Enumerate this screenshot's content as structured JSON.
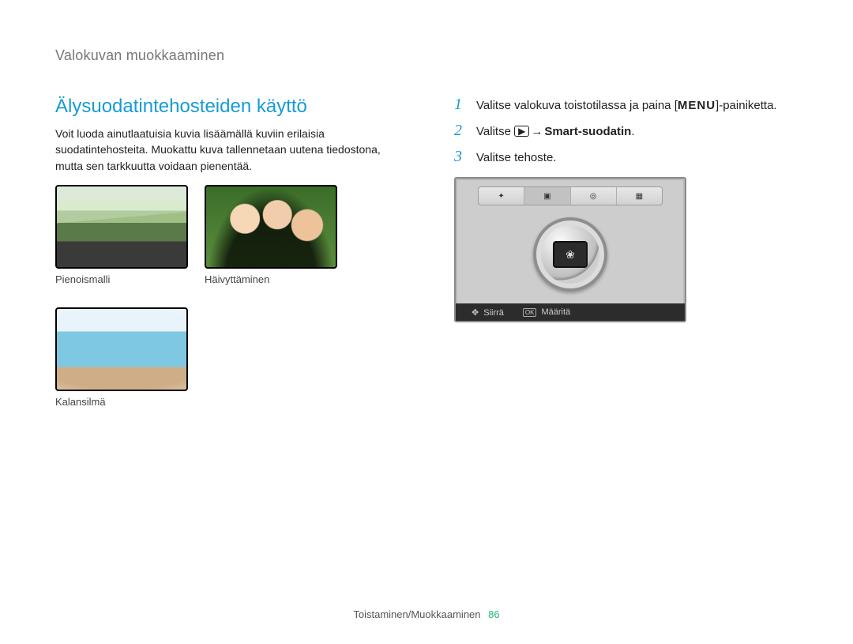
{
  "header": {
    "title": "Valokuvan muokkaaminen"
  },
  "section": {
    "title": "Älysuodatintehosteiden käyttö",
    "intro": "Voit luoda ainutlaatuisia kuvia lisäämällä kuviin erilaisia suodatintehosteita. Muokattu kuva tallennetaan uutena tiedostona, mutta sen tarkkuutta voidaan pienentää."
  },
  "thumbs": {
    "t1": "Pienoismalli",
    "t2": "Häivyttäminen",
    "t3": "Kalansilmä"
  },
  "steps": {
    "s1_pre": "Valitse valokuva toistotilassa ja paina [",
    "s1_key": "MENU",
    "s1_post": "]-painiketta.",
    "s2_pre": "Valitse ",
    "s2_tri": "▶",
    "s2_arrow": " → ",
    "s2_bold": "Smart-suodatin",
    "s2_post": ".",
    "s3": "Valitse tehoste."
  },
  "cam": {
    "move": "Siirrä",
    "ok": "OK",
    "set": "Määritä"
  },
  "footer": {
    "text": "Toistaminen/Muokkaaminen",
    "page": "86"
  }
}
